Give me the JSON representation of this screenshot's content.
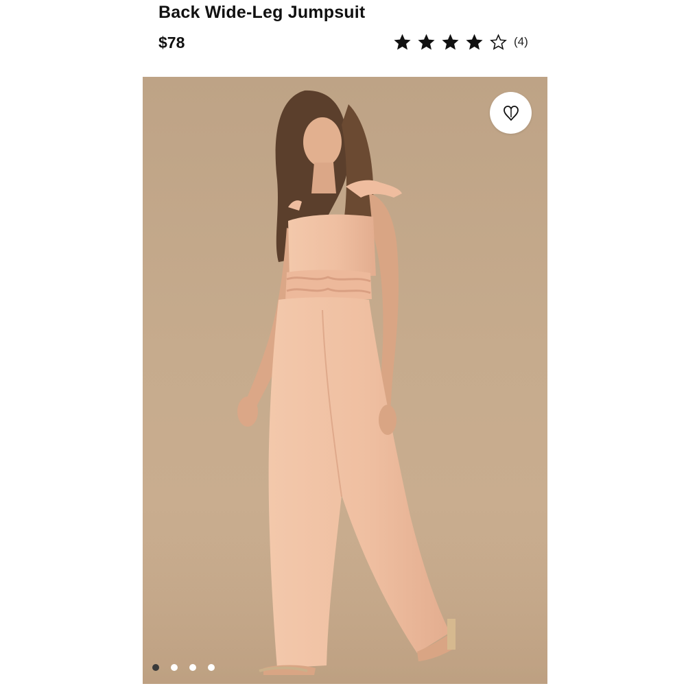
{
  "product": {
    "title_line": "Back Wide-Leg Jumpsuit",
    "price": "$78",
    "rating": {
      "value": 4,
      "max": 5,
      "count_text": "(4)"
    }
  },
  "gallery": {
    "slide_count": 4,
    "active_index": 0
  },
  "icons": {
    "wishlist": "heart-icon",
    "rating": "star-icon"
  },
  "colors": {
    "text": "#111111",
    "background_photo": "#c6ab8d",
    "garment": "#efc1a4",
    "dot_active": "#3a3a3a",
    "dot_inactive": "#ffffff"
  }
}
